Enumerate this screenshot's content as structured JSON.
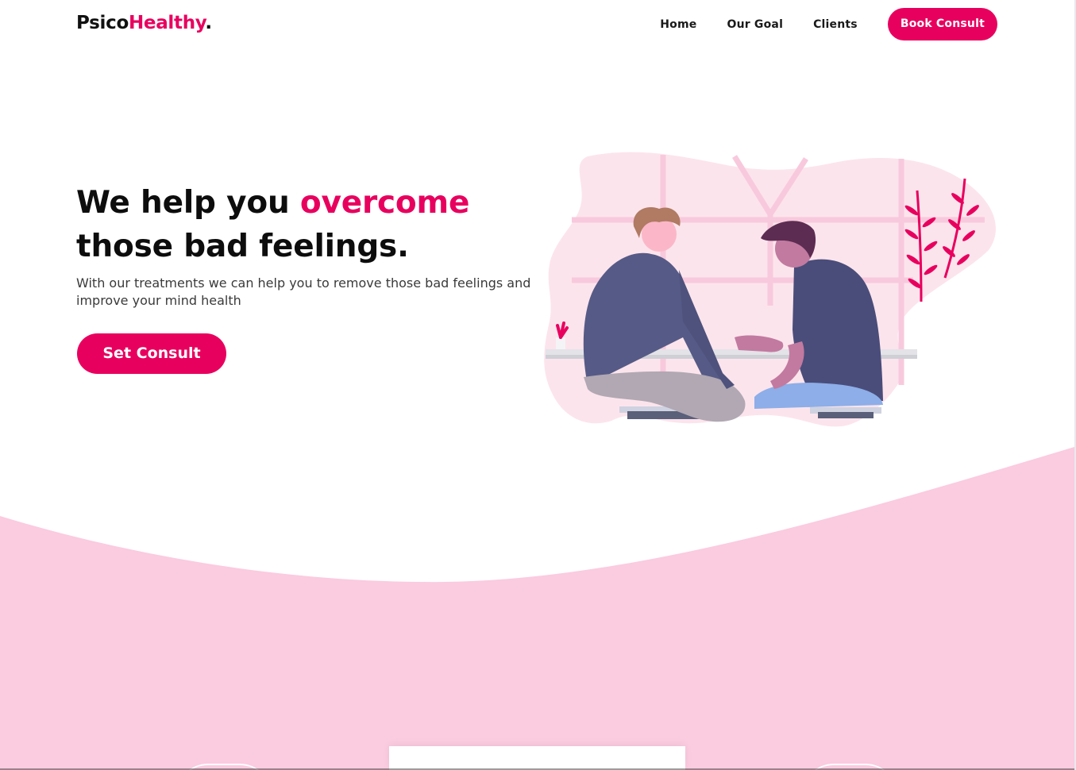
{
  "brand": {
    "name_part1": "Psico",
    "name_part2": "Healthy",
    "name_dot": "."
  },
  "nav": {
    "links": [
      {
        "label": "Home"
      },
      {
        "label": "Our Goal"
      },
      {
        "label": "Clients"
      }
    ],
    "cta_label": "Book Consult"
  },
  "hero": {
    "title_part1": "We help you ",
    "title_accent": "overcome",
    "title_part2": "those bad feelings.",
    "subtitle": "With our treatments we can help you to remove those bad feelings and improve your mind health",
    "button_label": "Set Consult"
  },
  "colors": {
    "accent": "#e8005e",
    "wave_pink": "#fbcbdf",
    "blob_pink": "#fce4ec",
    "text_dark": "#111111"
  },
  "icons": {
    "illustration": "two-people-talking-illustration",
    "plant": "plant-icon"
  }
}
